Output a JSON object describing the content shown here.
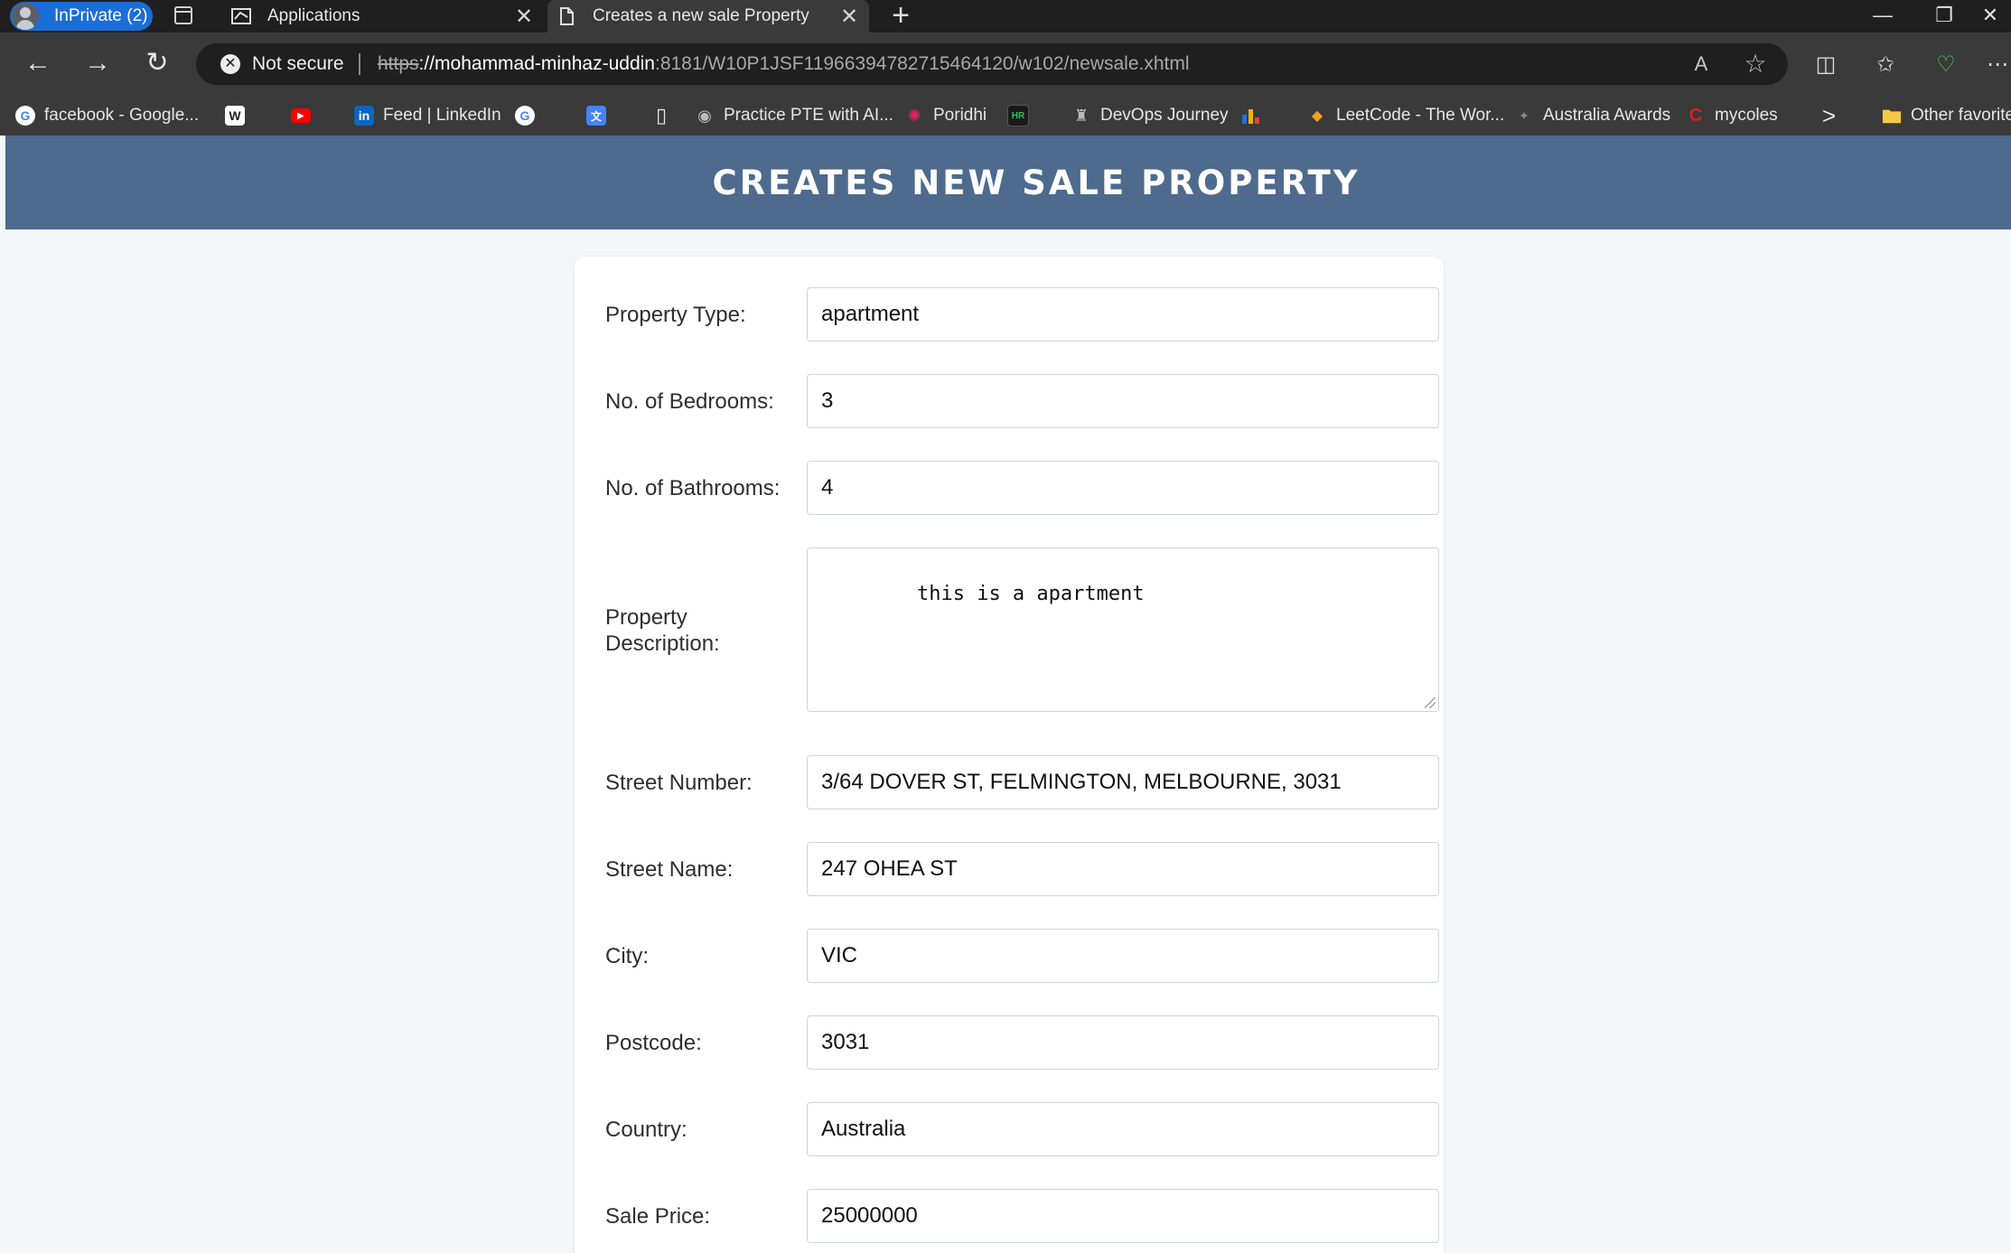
{
  "browser": {
    "profile_label": "InPrivate (2)",
    "tabs": [
      {
        "title": "Applications",
        "close": "✕"
      },
      {
        "title": "Creates a new sale Property",
        "close": "✕"
      }
    ],
    "new_tab": "+",
    "window_controls": [
      "—",
      "❐",
      "✕"
    ],
    "security_text": "Not secure",
    "security_icon_glyph": "✕",
    "url_scheme": "https",
    "url_host": "://mohammad-minhaz-uddin",
    "url_rest": ":8181/W10P1JSF11966394782715464120/w102/newsale.xhtml",
    "nav_glyphs": {
      "back": "←",
      "forward": "→",
      "reload": "↻"
    },
    "address_icons": {
      "read_aloud": "A",
      "favorite": "☆"
    },
    "toolbar_glyphs": {
      "split": "◫",
      "favorites": "✩",
      "health": "♡",
      "more": "⋯"
    }
  },
  "bookmarks": [
    {
      "label": "facebook - Google...",
      "icon": "G",
      "icon_color": "#4285f4"
    },
    {
      "label": "",
      "icon": "W",
      "icon_color": "#ffffff"
    },
    {
      "label": "",
      "icon": "▶",
      "icon_color": "#ff0000"
    },
    {
      "label": "Feed | LinkedIn",
      "icon": "in",
      "icon_color": "#0a66c2"
    },
    {
      "label": "",
      "icon": "G",
      "icon_color": "#4285f4"
    },
    {
      "label": "",
      "icon": "文",
      "icon_color": "#4285f4"
    },
    {
      "label": "",
      "icon": "▯",
      "icon_color": "#e6e6e6"
    },
    {
      "label": "Practice PTE with AI...",
      "icon": "◉",
      "icon_color": "#bbbbbb"
    },
    {
      "label": "Poridhi",
      "icon": "✺",
      "icon_color": "#e0245e"
    },
    {
      "label": "",
      "icon": "HR",
      "icon_color": "#2ec866"
    },
    {
      "label": "DevOps Journey",
      "icon": "♜",
      "icon_color": "#bbbbbb"
    },
    {
      "label": "",
      "icon": "▮",
      "icon_color": "#f4b400"
    },
    {
      "label": "LeetCode - The Wor...",
      "icon": "◆",
      "icon_color": "#f89f1b"
    },
    {
      "label": "Australia Awards",
      "icon": "✦",
      "icon_color": "#888888"
    },
    {
      "label": "mycoles",
      "icon": "C",
      "icon_color": "#e01a22"
    }
  ],
  "bookmarks_more": ">",
  "other_favorites": "Other favorite",
  "page": {
    "title": "CREATES NEW SALE PROPERTY",
    "form": {
      "property_type": {
        "label": "Property Type:",
        "value": "apartment"
      },
      "bedrooms": {
        "label": "No. of Bedrooms:",
        "value": "3"
      },
      "bathrooms": {
        "label": "No. of Bathrooms:",
        "value": "4"
      },
      "description": {
        "label": "Property Description:",
        "value": "this is a apartment"
      },
      "street_number": {
        "label": "Street Number:",
        "value": "3/64 DOVER ST, FELMINGTON, MELBOURNE, 3031"
      },
      "street_name": {
        "label": "Street Name:",
        "value": "247 OHEA ST"
      },
      "city": {
        "label": "City:",
        "value": "VIC"
      },
      "postcode": {
        "label": "Postcode:",
        "value": "3031"
      },
      "country": {
        "label": "Country:",
        "value": "Australia"
      },
      "sale_price": {
        "label": "Sale Price:",
        "value": "25000000"
      }
    }
  }
}
